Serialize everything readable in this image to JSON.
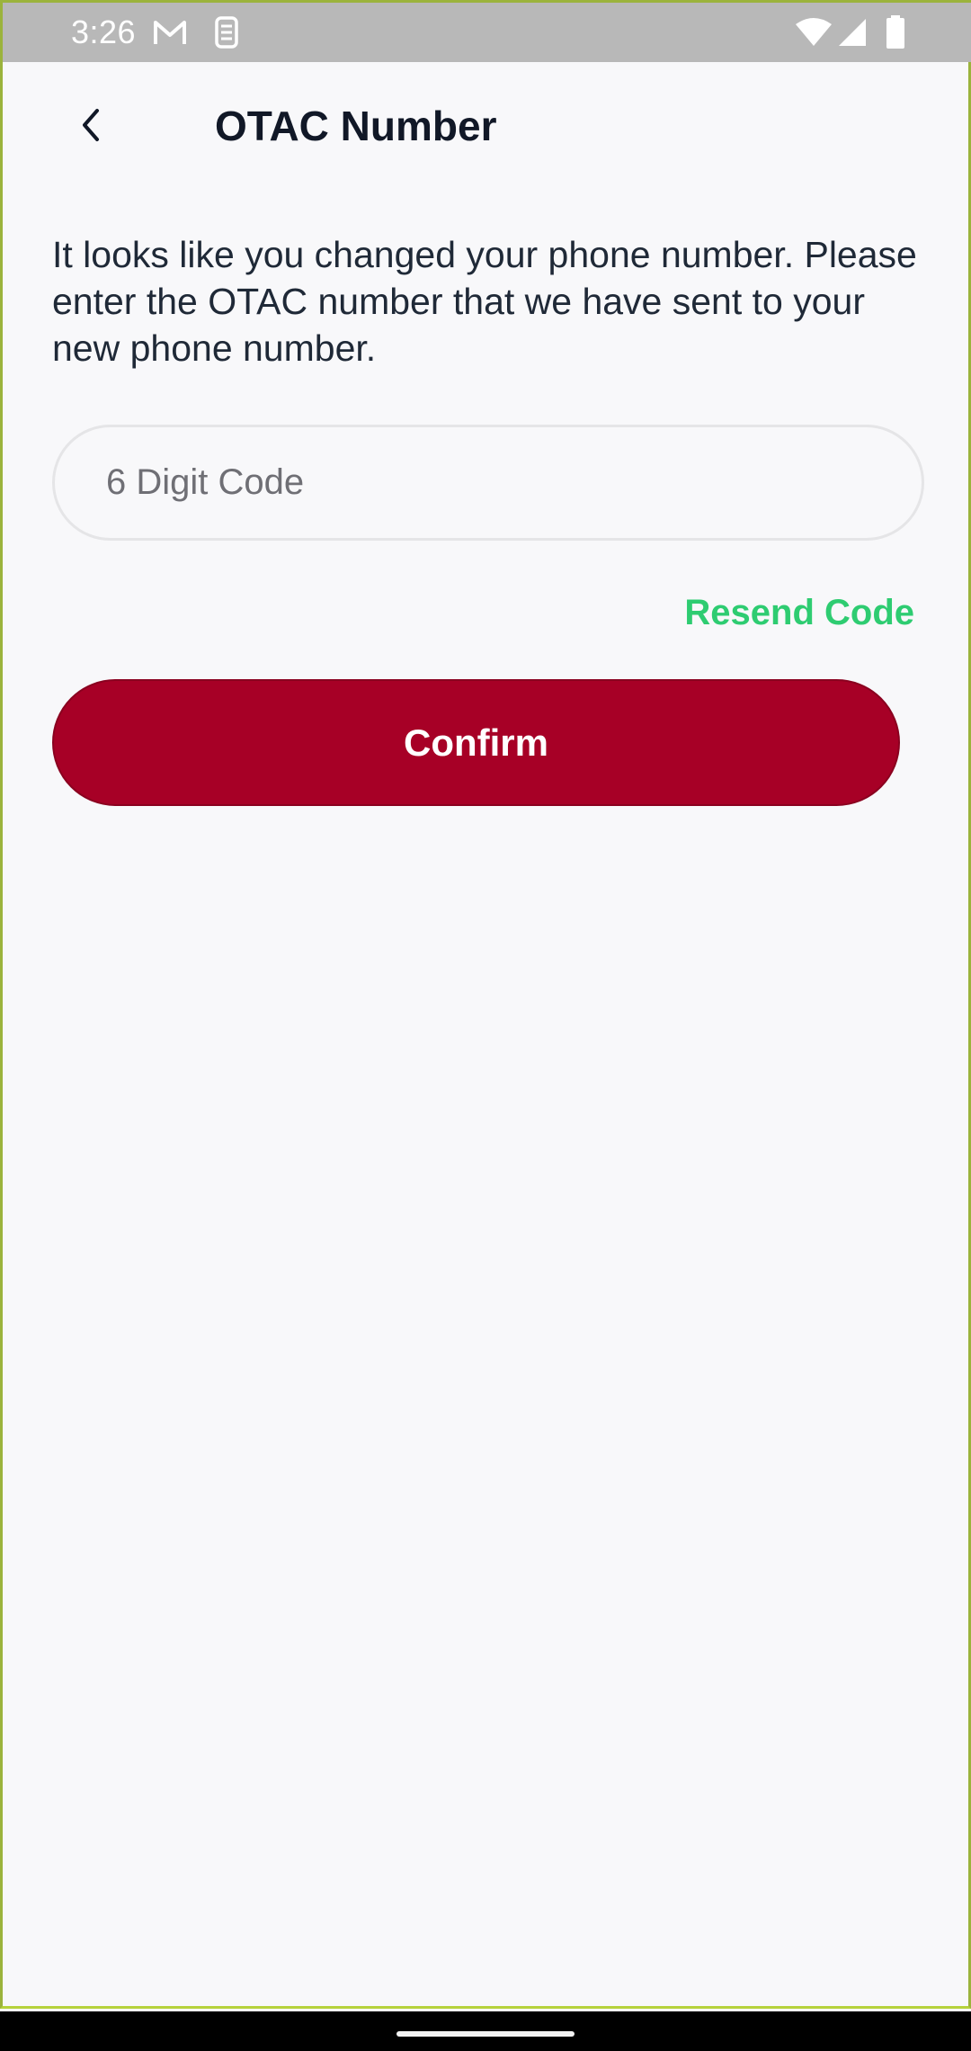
{
  "status_bar": {
    "time": "3:26",
    "icons": [
      "gmail-icon",
      "sim-icon",
      "wifi-icon",
      "signal-icon",
      "battery-icon"
    ]
  },
  "header": {
    "back_icon": "chevron-left-icon",
    "title": "OTAC Number"
  },
  "main": {
    "message": "It looks like you changed your phone number. Please enter the OTAC number that we have sent to your new phone number.",
    "code_input": {
      "placeholder": "6 Digit Code",
      "value": ""
    },
    "resend_label": "Resend Code",
    "confirm_label": "Confirm"
  },
  "colors": {
    "accent": "#a70026",
    "link": "#2ecc71",
    "background": "#f8f8fa"
  }
}
